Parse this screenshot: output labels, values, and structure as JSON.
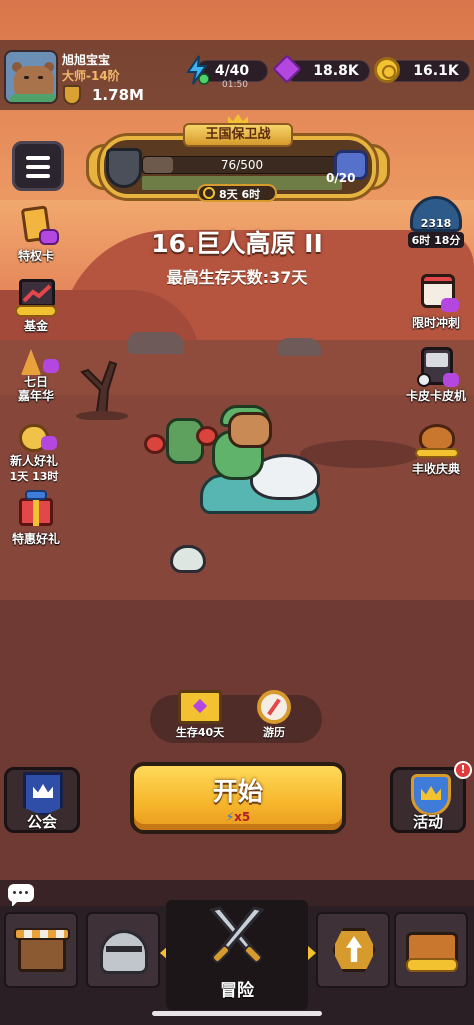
{
  "player": {
    "name": "旭旭宝宝",
    "rank": "大师-14阶",
    "power": "1.78M"
  },
  "resources": {
    "energy": "4/40",
    "energy_timer": "01:50",
    "gems": "18.8K",
    "coins": "16.1K"
  },
  "event": {
    "title": "王国保卫战",
    "progress_text": "76/500",
    "progress_fraction": 0.152,
    "chest_count": "0/20",
    "time_left": "8天 6时"
  },
  "stage": {
    "title": "16.巨人高原 II",
    "best_survival": "最高生存天数:37天"
  },
  "left_menu": [
    {
      "label": "特权卡"
    },
    {
      "label": "基金"
    },
    {
      "label": "七日",
      "sub_label": "嘉年华"
    },
    {
      "label": "新人好礼",
      "sub_label": "1天 13时"
    },
    {
      "label": "特惠好礼"
    }
  ],
  "right_menu": [
    {
      "label": "2318",
      "sub_label": "6时 18分"
    },
    {
      "label": "限时冲刺"
    },
    {
      "label": "卡皮卡皮机"
    },
    {
      "label": "丰收庆典"
    }
  ],
  "mini_actions": {
    "survival": "生存40天",
    "travel": "游历"
  },
  "start": {
    "label": "开始",
    "cost": "x5"
  },
  "guild": {
    "label": "公会"
  },
  "activity": {
    "label": "活动",
    "badge": "!"
  },
  "nav": {
    "active_label": "冒险"
  },
  "colors": {
    "gold": "#f2c230",
    "gem": "#b447e0",
    "start_button": "#f6b52b",
    "badge_red": "#e23b3b"
  }
}
